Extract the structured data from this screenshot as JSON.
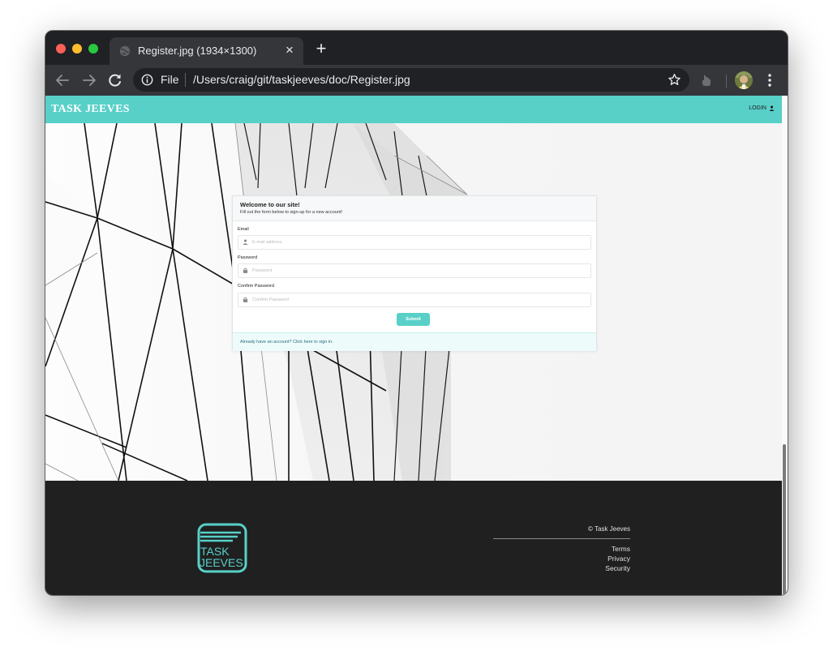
{
  "browser": {
    "tab_title": "Register.jpg (1934×1300)",
    "address_scheme": "File",
    "address_url": "/Users/craig/git/taskjeeves/doc/Register.jpg"
  },
  "site": {
    "brand": "TASK JEEVES",
    "login_label": "LOGIN",
    "accent_color": "#58d0c8"
  },
  "form": {
    "title": "Welcome to our site!",
    "subtitle": "Fill out the form below to sign-up for a new account!",
    "email_label": "Email",
    "email_placeholder": "E-mail address",
    "password_label": "Password",
    "password_placeholder": "Password",
    "confirm_label": "Confirm Password",
    "confirm_placeholder": "Confirm Password",
    "submit_label": "Submit",
    "signin_text": "Already have an account? Click here to sign in."
  },
  "footer": {
    "logo_line1": "TASK",
    "logo_line2": "JEEVES",
    "copyright": "© Task Jeeves",
    "links": [
      "Terms",
      "Privacy",
      "Security"
    ]
  }
}
